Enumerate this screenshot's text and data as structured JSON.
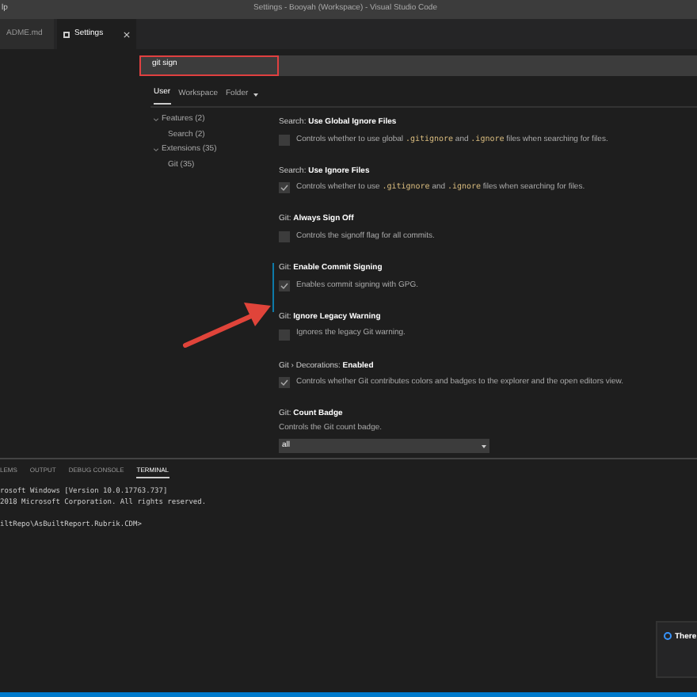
{
  "window": {
    "title": "Settings - Booyah (Workspace) - Visual Studio Code",
    "menu_fragment": "lp"
  },
  "editor_tabs": [
    {
      "label": "ADME.md",
      "selected": false
    },
    {
      "label": "Settings",
      "selected": true
    }
  ],
  "search": {
    "value": "git sign"
  },
  "scope_tabs": [
    {
      "label": "User",
      "selected": true,
      "dropdown": false
    },
    {
      "label": "Workspace",
      "selected": false,
      "dropdown": false
    },
    {
      "label": "Folder",
      "selected": false,
      "dropdown": true
    }
  ],
  "toc": [
    {
      "label": "Features (2)",
      "expanded": true,
      "children": [
        {
          "label": "Search (2)"
        }
      ]
    },
    {
      "label": "Extensions (35)",
      "expanded": true,
      "children": [
        {
          "label": "Git (35)"
        }
      ]
    }
  ],
  "settings": [
    {
      "kind": "checkbox",
      "category": "Search: ",
      "name": "Use Global Ignore Files",
      "checked": false,
      "focused": false,
      "description": [
        {
          "text": "Controls whether to use global ",
          "code": false
        },
        {
          "text": ".gitignore",
          "code": true
        },
        {
          "text": " and ",
          "code": false
        },
        {
          "text": ".ignore",
          "code": true
        },
        {
          "text": " files when searching for files.",
          "code": false
        }
      ]
    },
    {
      "kind": "checkbox",
      "category": "Search: ",
      "name": "Use Ignore Files",
      "checked": true,
      "focused": false,
      "description": [
        {
          "text": "Controls whether to use ",
          "code": false
        },
        {
          "text": ".gitignore",
          "code": true
        },
        {
          "text": " and ",
          "code": false
        },
        {
          "text": ".ignore",
          "code": true
        },
        {
          "text": " files when searching for files.",
          "code": false
        }
      ]
    },
    {
      "kind": "checkbox",
      "category": "Git: ",
      "name": "Always Sign Off",
      "checked": false,
      "focused": false,
      "description": [
        {
          "text": "Controls the signoff flag for all commits.",
          "code": false
        }
      ]
    },
    {
      "kind": "checkbox",
      "category": "Git: ",
      "name": "Enable Commit Signing",
      "checked": true,
      "focused": true,
      "description": [
        {
          "text": "Enables commit signing with GPG.",
          "code": false
        }
      ]
    },
    {
      "kind": "checkbox",
      "category": "Git: ",
      "name": "Ignore Legacy Warning",
      "checked": false,
      "focused": false,
      "description": [
        {
          "text": "Ignores the legacy Git warning.",
          "code": false
        }
      ]
    },
    {
      "kind": "checkbox",
      "category": "Git › Decorations: ",
      "name": "Enabled",
      "checked": true,
      "focused": false,
      "description": [
        {
          "text": "Controls whether Git contributes colors and badges to the explorer and the open editors view.",
          "code": false
        }
      ]
    },
    {
      "kind": "dropdown",
      "category": "Git: ",
      "name": "Count Badge",
      "value": "all",
      "focused": false,
      "description": [
        {
          "text": "Controls the Git count badge.",
          "code": false
        }
      ]
    }
  ],
  "panel_tabs": [
    {
      "label": "LEMS",
      "selected": false
    },
    {
      "label": "OUTPUT",
      "selected": false
    },
    {
      "label": "DEBUG CONSOLE",
      "selected": false
    },
    {
      "label": "TERMINAL",
      "selected": true
    }
  ],
  "terminal_blocks": [
    [
      "rosoft Windows [Version 10.0.17763.737]",
      "2018 Microsoft Corporation. All rights reserved."
    ],
    [
      "iltRepo\\AsBuiltReport.Rubrik.CDM>"
    ]
  ],
  "notification": {
    "text": "There"
  }
}
